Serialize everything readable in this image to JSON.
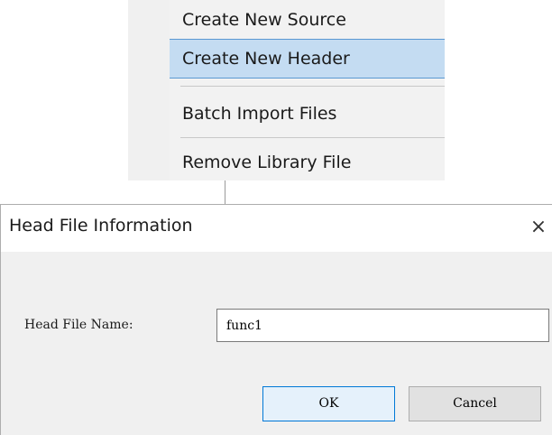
{
  "context_menu": {
    "items": [
      {
        "label": "Create New Source",
        "highlighted": false
      },
      {
        "label": "Create New Header",
        "highlighted": true
      },
      {
        "label": "Batch Import Files",
        "highlighted": false
      },
      {
        "label": "Remove Library File",
        "highlighted": false
      }
    ]
  },
  "dialog": {
    "title": "Head File Information",
    "close_glyph": "×",
    "field_label": "Head File Name:",
    "field_value": "func1",
    "ok_label": "OK",
    "cancel_label": "Cancel"
  },
  "colors": {
    "menu_highlight": "#c4dcf2",
    "menu_highlight_border": "#5a98d2",
    "ok_border": "#0078d7"
  }
}
